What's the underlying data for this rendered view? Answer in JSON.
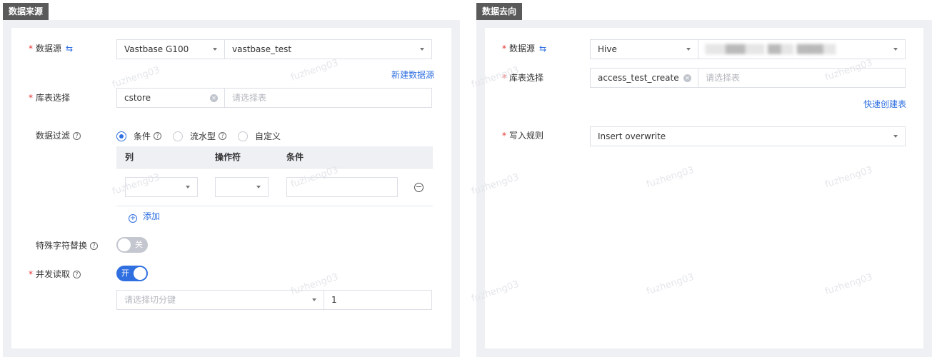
{
  "watermark": "fuzheng03",
  "source": {
    "title": "数据来源",
    "datasource_label": "数据源",
    "datasource_type": "Vastbase G100",
    "datasource_name": "vastbase_test",
    "new_datasource_link": "新建数据源",
    "table_label": "库表选择",
    "schema_value": "cstore",
    "table_placeholder": "请选择表",
    "filter_label": "数据过滤",
    "filter_options": [
      "条件",
      "流水型",
      "自定义"
    ],
    "filter_selected": "条件",
    "filter_table": {
      "headers": [
        "列",
        "操作符",
        "条件"
      ]
    },
    "add_label": "添加",
    "special_char_label": "特殊字符替换",
    "special_char_toggle": "关",
    "concurrent_label": "并发读取",
    "concurrent_toggle": "开",
    "split_key_placeholder": "请选择切分键",
    "concurrency_value": "1"
  },
  "target": {
    "title": "数据去向",
    "datasource_label": "数据源",
    "datasource_type": "Hive",
    "table_label": "库表选择",
    "table_db_value": "access_test_create",
    "table_placeholder": "请选择表",
    "quick_create_link": "快速创建表",
    "write_rule_label": "写入规则",
    "write_rule_value": "Insert overwrite"
  }
}
